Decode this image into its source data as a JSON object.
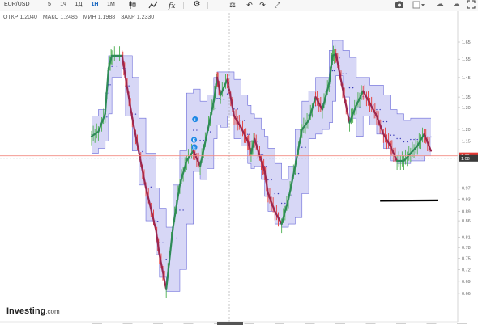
{
  "toolbar": {
    "symbol": "EUR/USD",
    "intervals": [
      "5",
      "1ч",
      "1Д",
      "1Н",
      "1М"
    ],
    "active_interval": "1Н",
    "icons": [
      "candles-icon",
      "line-chart-icon",
      "indicators-icon",
      "gear-icon",
      "scales-icon",
      "undo-icon",
      "redo-icon",
      "expand-icon",
      "camera-icon",
      "color-icon",
      "cloud-save-icon",
      "cloud-load-icon",
      "fullscreen-icon"
    ]
  },
  "ohlc": {
    "open_label": "ОТКР",
    "open": "1.2040",
    "high_label": "МАКС",
    "high": "1.2485",
    "low_label": "МИН",
    "low": "1.1988",
    "close_label": "ЗАКР",
    "close": "1.2330"
  },
  "branding": {
    "logo": "Investing",
    "logo_suffix": ".com"
  },
  "colors": {
    "band_fill": "#c9c9f3",
    "band_edge": "#6b6bd9",
    "trend_up": "#2e8b57",
    "trend_down": "#9b2750",
    "candle_up": "#4caf50",
    "candle_down": "#e53935",
    "dots": "#3d3db8",
    "price_line": "#f28b82",
    "crosshair": "#9e9e9e",
    "annotation": "#000000",
    "marker": "#1e88e5"
  },
  "chart_data": {
    "type": "line",
    "title": "EUR/USD",
    "interval": "1Н",
    "y_axis": {
      "range": [
        0.635,
        1.74
      ],
      "ticks": [
        "1.65",
        "1.55",
        "1.45",
        "1.35",
        "1.30",
        "1.20",
        "1.15",
        "1.09",
        "1.08",
        "0.97",
        "0.93",
        "0.89",
        "0.86",
        "0.81",
        "0.78",
        "0.75",
        "0.72",
        "0.69",
        "0.66"
      ],
      "current_price": "1.09",
      "crosshair_price": "1.08",
      "scale": "log"
    },
    "x_axis": {
      "labels": [],
      "readable": false
    },
    "series": [
      {
        "kind": "price-trend",
        "x": [
          0,
          2,
          4,
          5,
          6,
          9,
          10,
          12,
          14,
          16,
          19,
          20,
          22,
          24,
          26,
          28,
          30,
          32,
          34,
          36,
          37,
          38,
          40,
          42,
          44,
          46,
          47,
          48,
          50,
          51,
          52,
          54,
          56,
          58,
          60,
          62,
          64,
          66,
          68,
          70,
          71,
          72,
          74,
          76,
          78,
          80,
          82,
          84,
          86,
          88,
          90,
          92,
          94,
          96,
          98,
          100
        ],
        "values": [
          1.17,
          1.19,
          1.27,
          1.5,
          1.57,
          1.57,
          1.45,
          1.25,
          1.1,
          0.97,
          0.83,
          0.76,
          0.67,
          0.84,
          0.98,
          1.07,
          1.11,
          1.05,
          1.18,
          1.33,
          1.45,
          1.36,
          1.44,
          1.26,
          1.21,
          1.15,
          1.1,
          1.16,
          1.07,
          1.03,
          0.95,
          0.89,
          0.85,
          0.93,
          1.05,
          1.2,
          1.24,
          1.35,
          1.29,
          1.42,
          1.57,
          1.58,
          1.39,
          1.23,
          1.31,
          1.38,
          1.32,
          1.26,
          1.18,
          1.13,
          1.07,
          1.07,
          1.1,
          1.13,
          1.18,
          1.11
        ]
      },
      {
        "kind": "channel-upper",
        "x": [
          0,
          2,
          4,
          5,
          6,
          9,
          10,
          12,
          14,
          16,
          19,
          20,
          22,
          24,
          26,
          28,
          30,
          32,
          34,
          36,
          37,
          38,
          40,
          42,
          44,
          46,
          47,
          48,
          50,
          51,
          52,
          54,
          56,
          58,
          60,
          62,
          64,
          66,
          68,
          70,
          71,
          72,
          74,
          76,
          78,
          80,
          82,
          84,
          86,
          88,
          90,
          92,
          94,
          96,
          98,
          100
        ],
        "values": [
          1.26,
          1.29,
          1.37,
          1.57,
          1.57,
          1.57,
          1.57,
          1.45,
          1.25,
          1.1,
          0.97,
          0.9,
          0.84,
          0.98,
          1.11,
          1.37,
          1.39,
          1.33,
          1.36,
          1.45,
          1.48,
          1.48,
          1.48,
          1.44,
          1.36,
          1.31,
          1.27,
          1.25,
          1.2,
          1.17,
          1.12,
          1.06,
          1.0,
          1.05,
          1.2,
          1.33,
          1.38,
          1.45,
          1.45,
          1.6,
          1.66,
          1.66,
          1.6,
          1.56,
          1.45,
          1.45,
          1.41,
          1.41,
          1.36,
          1.29,
          1.27,
          1.24,
          1.25,
          1.25,
          1.25,
          1.25
        ]
      },
      {
        "kind": "channel-lower",
        "x": [
          0,
          2,
          4,
          5,
          6,
          9,
          10,
          12,
          14,
          16,
          19,
          20,
          22,
          24,
          26,
          28,
          30,
          32,
          34,
          36,
          37,
          38,
          40,
          42,
          44,
          46,
          47,
          48,
          50,
          51,
          52,
          54,
          56,
          58,
          60,
          62,
          64,
          66,
          68,
          70,
          71,
          72,
          74,
          76,
          78,
          80,
          82,
          84,
          86,
          88,
          90,
          92,
          94,
          96,
          98,
          100
        ],
        "values": [
          1.1,
          1.12,
          1.15,
          1.27,
          1.45,
          1.5,
          1.26,
          1.11,
          0.98,
          0.86,
          0.76,
          0.7,
          0.665,
          0.665,
          0.72,
          0.85,
          1.03,
          1.0,
          1.04,
          1.16,
          1.22,
          1.21,
          1.26,
          1.16,
          1.13,
          1.06,
          1.04,
          1.05,
          1.0,
          0.94,
          0.89,
          0.85,
          0.84,
          0.85,
          0.87,
          0.95,
          1.16,
          1.18,
          1.2,
          1.23,
          1.33,
          1.46,
          1.35,
          1.25,
          1.17,
          1.26,
          1.22,
          1.18,
          1.12,
          1.07,
          1.06,
          1.06,
          1.07,
          1.07,
          1.09,
          1.09
        ]
      }
    ],
    "annotation_segment": {
      "x": [
        85,
        100
      ],
      "value": 0.925
    },
    "event_markers": [
      {
        "label": "i",
        "x": 30.5,
        "value": 1.245
      },
      {
        "label": "E",
        "x": 30.2,
        "value": 1.155
      },
      {
        "label": "E",
        "x": 30.3,
        "value": 1.125
      }
    ],
    "grid": false,
    "legend": "none"
  }
}
